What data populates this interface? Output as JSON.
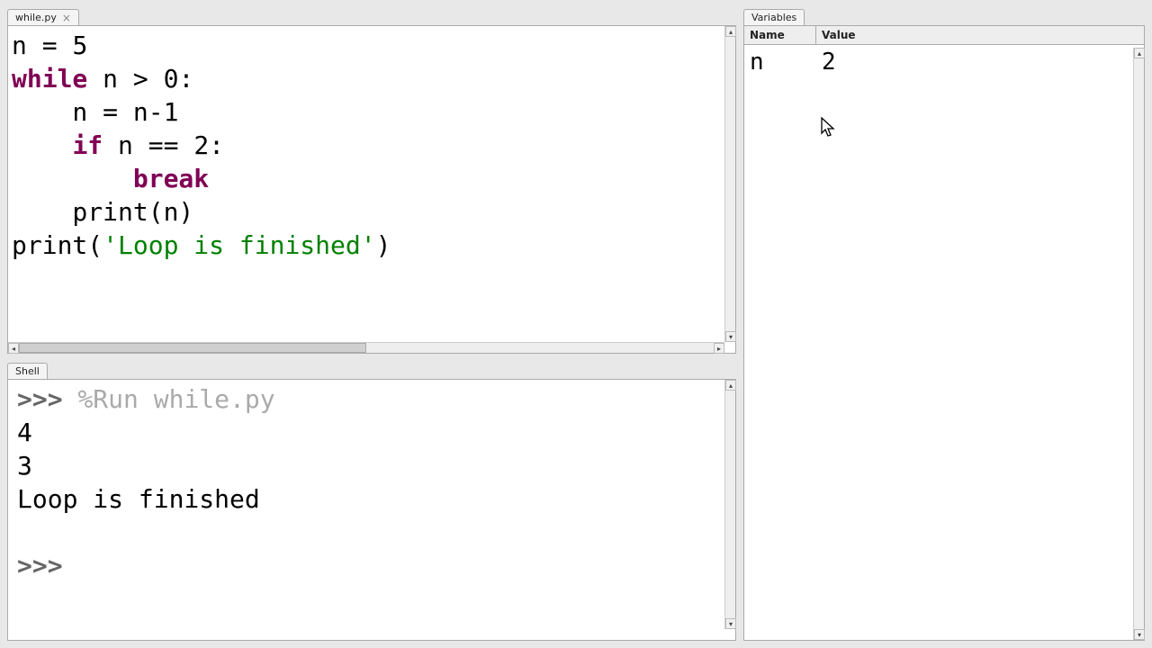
{
  "tabs": {
    "editor": "while.py",
    "shell": "Shell",
    "variables": "Variables"
  },
  "code": {
    "l1_a": "n = ",
    "l1_num": "5",
    "l2_kw": "while",
    "l2_rest": " n > ",
    "l2_num": "0",
    "l2_colon": ":",
    "l3": "    n = n-",
    "l3_num": "1",
    "l4_indent": "    ",
    "l4_kw": "if",
    "l4_rest": " n == ",
    "l4_num": "2",
    "l4_colon": ":",
    "l5_indent": "        ",
    "l5_kw": "break",
    "l6": "    print(n)",
    "l7_a": "print(",
    "l7_str": "'Loop is finished'",
    "l7_b": ")"
  },
  "shell": {
    "prompt": ">>>",
    "run_command": "%Run while.py",
    "out1": "4",
    "out2": "3",
    "out3": "Loop is finished"
  },
  "variables": {
    "header_name": "Name",
    "header_value": "Value",
    "rows": [
      {
        "name": "n",
        "value": "2"
      }
    ]
  }
}
